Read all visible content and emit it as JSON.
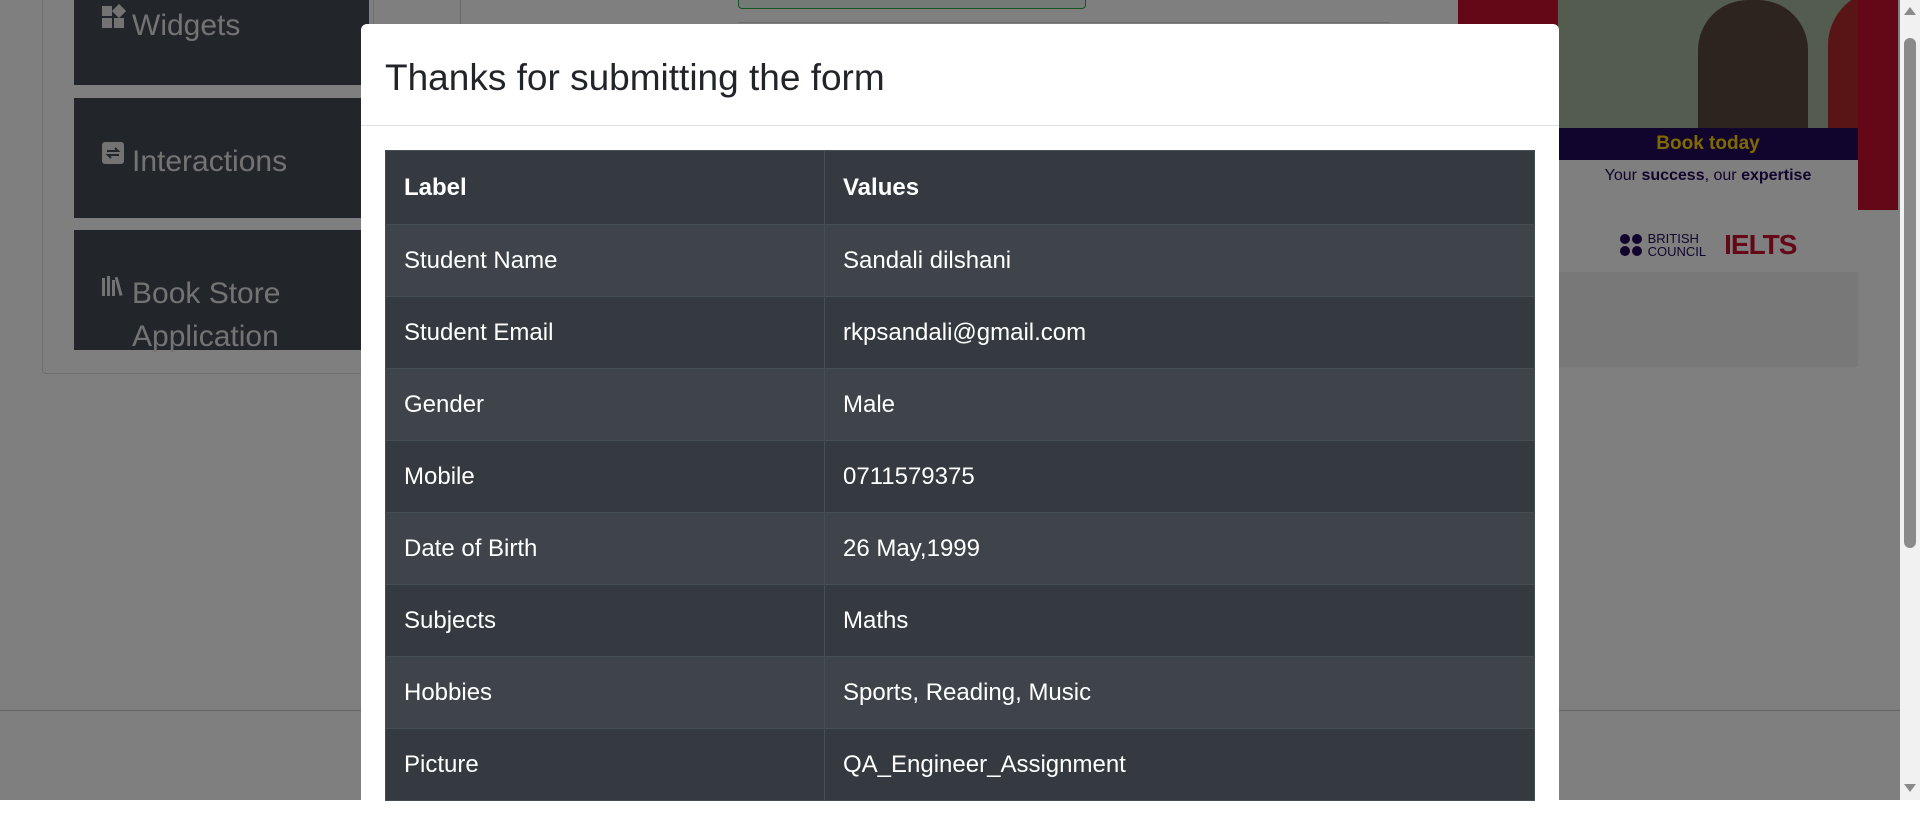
{
  "sidebar": {
    "items": [
      {
        "label": "Widgets",
        "icon": "widgets-icon"
      },
      {
        "label": "Interactions",
        "icon": "interactions-icon"
      },
      {
        "label": "Book Store Application",
        "icon": "book-store-icon"
      }
    ]
  },
  "ad": {
    "cta": "Book today",
    "tagline_prefix": "Your ",
    "tagline_bold1": "success",
    "tagline_mid": ", our ",
    "tagline_bold2": "expertise",
    "british_council_line1": "BRITISH",
    "british_council_line2": "COUNCIL",
    "brand": "IELTS"
  },
  "modal": {
    "title": "Thanks for submitting the form",
    "table": {
      "headers": [
        "Label",
        "Values"
      ],
      "rows": [
        [
          "Student Name",
          "Sandali dilshani"
        ],
        [
          "Student Email",
          "rkpsandali@gmail.com"
        ],
        [
          "Gender",
          "Male"
        ],
        [
          "Mobile",
          "0711579375"
        ],
        [
          "Date of Birth",
          "26 May,1999"
        ],
        [
          "Subjects",
          "Maths"
        ],
        [
          "Hobbies",
          "Sports, Reading, Music"
        ],
        [
          "Picture",
          "QA_Engineer_Assignment"
        ]
      ]
    }
  },
  "colors": {
    "table_dark": "#343a40",
    "table_stripe": "#3e444a",
    "ad_red": "#c8102e",
    "ad_navy": "#23085a",
    "ad_yellow": "#ffd400"
  }
}
